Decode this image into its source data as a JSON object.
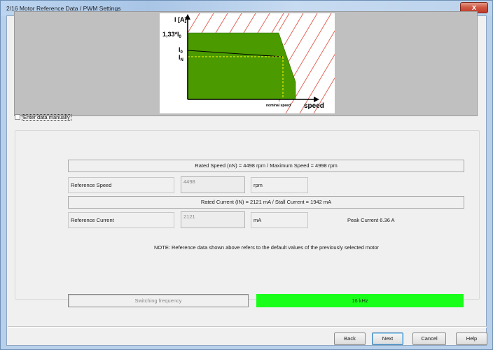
{
  "window": {
    "title": "2/16 Motor Reference Data / PWM Settings",
    "close_glyph": "x"
  },
  "graph": {
    "y_axis_label": "I [A]",
    "label_peak": "1,33*I",
    "label_peak_sub": "0",
    "label_i0": "I",
    "label_i0_sub": "0",
    "label_in": "I",
    "label_in_sub": "N",
    "x_nominal_label": "nominal speed",
    "x_axis_label": "speed",
    "colors": {
      "region": "#4a9a00",
      "hatch": "#e05a4a",
      "background": "#c0c0c0",
      "nominal_marker": "#ffff00"
    }
  },
  "manual_entry": {
    "label": "Enter data manually",
    "checked": false
  },
  "speed": {
    "info": "Rated Speed (nN)  = 4498 rpm / Maximum Speed = 4998 rpm",
    "label": "Reference Speed",
    "value": "4498",
    "unit": "rpm"
  },
  "current": {
    "info": "Rated Current (IN)  = 2121 mA / Stall Current = 1942 mA",
    "label": "Reference Current",
    "value": "2121",
    "unit": "mA",
    "peak": "Peak Current 6.36 A"
  },
  "note": "NOTE: Reference data shown above refers to the default values of the previously selected motor",
  "switching": {
    "label": "Switching frequency",
    "value": "16 kHz",
    "value_color": "#1aff1a"
  },
  "buttons": {
    "back": "Back",
    "next": "Next",
    "cancel": "Cancel",
    "help": "Help"
  }
}
